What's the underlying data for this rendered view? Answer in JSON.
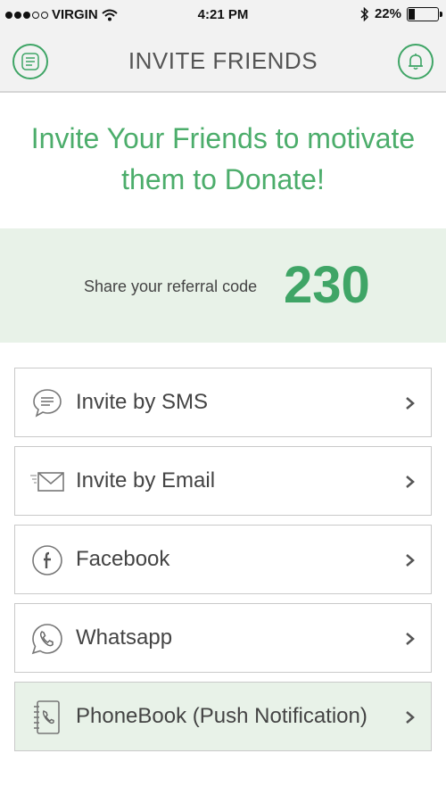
{
  "status_bar": {
    "carrier": "VIRGIN",
    "time": "4:21 PM",
    "battery": "22%",
    "battery_level": 0.22
  },
  "nav": {
    "title": "INVITE FRIENDS",
    "menu_icon": "menu-icon",
    "bell_icon": "bell-icon"
  },
  "headline": "Invite Your Friends to motivate them to Donate!",
  "referral": {
    "label": "Share your referral code",
    "code": "230"
  },
  "invite_options": [
    {
      "label": "Invite by SMS",
      "icon": "sms-icon"
    },
    {
      "label": "Invite by Email",
      "icon": "email-icon"
    },
    {
      "label": "Facebook",
      "icon": "facebook-icon"
    },
    {
      "label": "Whatsapp",
      "icon": "whatsapp-icon"
    },
    {
      "label": "PhoneBook (Push Notification)",
      "icon": "phonebook-icon"
    }
  ],
  "colors": {
    "accent": "#3fa566",
    "headline": "#4cad6b",
    "panel": "#e8f2e8"
  }
}
